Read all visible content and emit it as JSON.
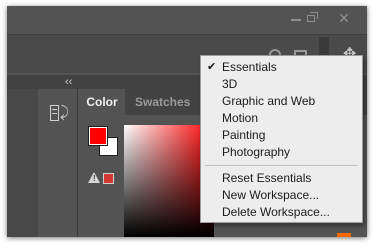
{
  "window": {
    "controls": {
      "minimize_icon": "minimize-icon",
      "restore_icon": "restore-icon",
      "close_glyph": "✕"
    }
  },
  "options_bar": {
    "icons": [
      "search-icon",
      "panel-icon",
      "move-icon"
    ],
    "move_glyph": "✥"
  },
  "panel_strip": {
    "collapse_glyph": "‹‹"
  },
  "panel": {
    "tabs": [
      {
        "label": "Color",
        "active": true
      },
      {
        "label": "Swatches",
        "active": false
      }
    ],
    "foreground_color": "#ff0000",
    "background_color": "#ffffff",
    "gamut_warning_color": "#d23a33",
    "warning_glyph": "!"
  },
  "workspace_menu": {
    "checkmark": "✔",
    "items": [
      {
        "label": "Essentials",
        "checked": true
      },
      {
        "label": "3D",
        "checked": false
      },
      {
        "label": "Graphic and Web",
        "checked": false
      },
      {
        "label": "Motion",
        "checked": false
      },
      {
        "label": "Painting",
        "checked": false
      },
      {
        "label": "Photography",
        "checked": false
      }
    ],
    "actions": [
      {
        "label": "Reset Essentials"
      },
      {
        "label": "New Workspace..."
      },
      {
        "label": "Delete Workspace..."
      }
    ]
  },
  "colors": {
    "app_background": "#535353",
    "menu_background": "#ededed",
    "accent_slider": "#ff6a00"
  }
}
